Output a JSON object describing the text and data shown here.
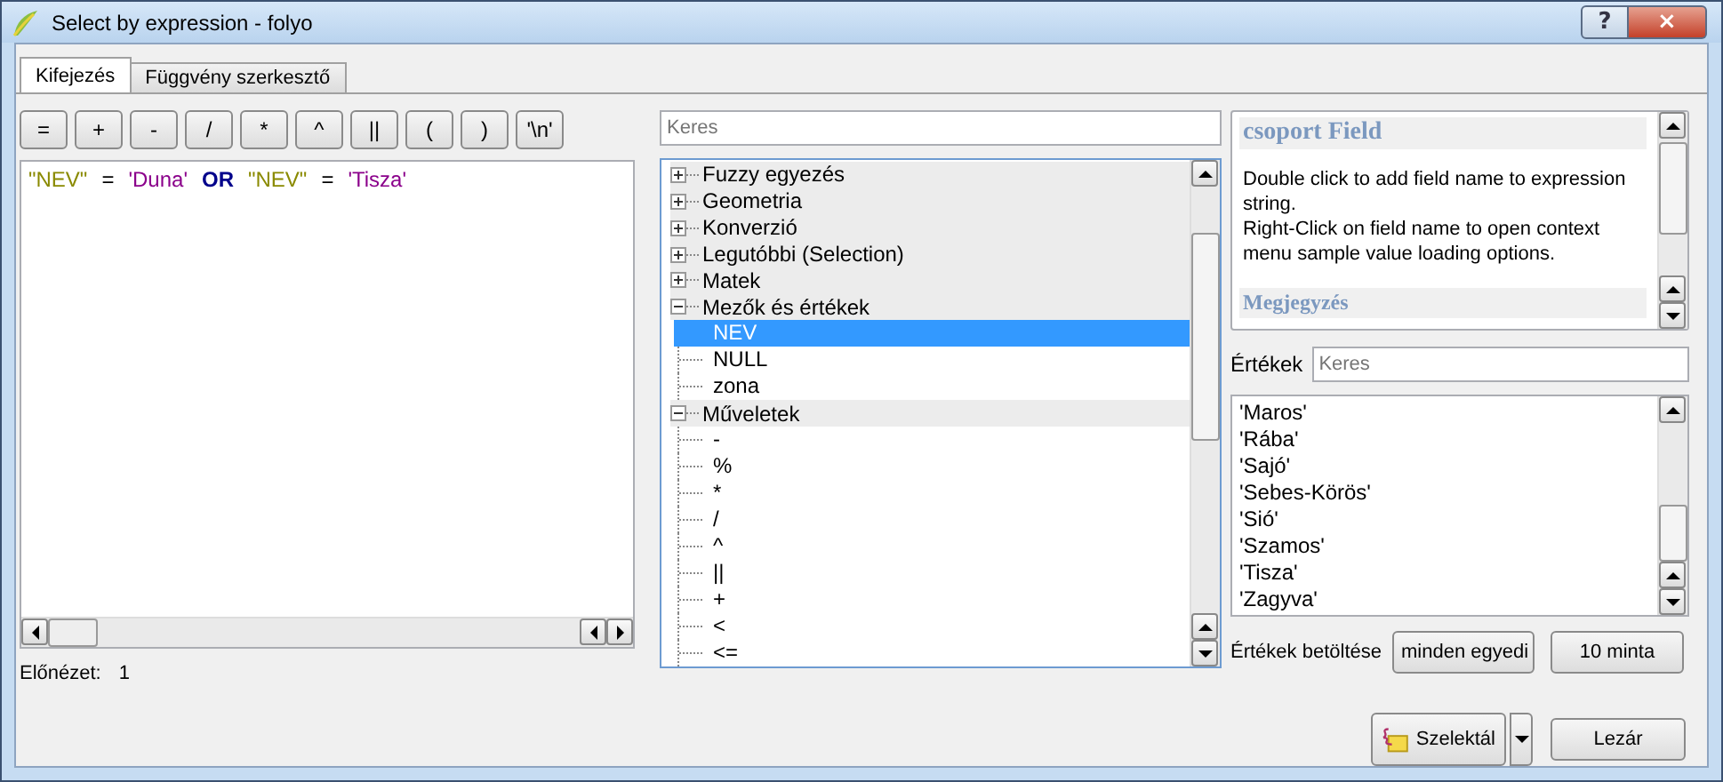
{
  "window": {
    "title": "Select by expression - folyo",
    "help_button": "?",
    "close_button": "×"
  },
  "tabs": [
    {
      "label": "Kifejezés",
      "selected": true
    },
    {
      "label": "Függvény szerkesztő",
      "selected": false
    }
  ],
  "operators": [
    "=",
    "+",
    "-",
    "/",
    "*",
    "^",
    "||",
    "(",
    ")",
    "'\\n'"
  ],
  "expression": [
    {
      "kind": "field",
      "text": "\"NEV\""
    },
    {
      "kind": "operator",
      "text": "="
    },
    {
      "kind": "string",
      "text": "'Duna'"
    },
    {
      "kind": "keyword",
      "text": "OR"
    },
    {
      "kind": "field",
      "text": "\"NEV\""
    },
    {
      "kind": "operator",
      "text": "="
    },
    {
      "kind": "string",
      "text": "'Tisza'"
    }
  ],
  "preview": {
    "label": "Előnézet:",
    "value": "1"
  },
  "function_search": {
    "placeholder": "Keres"
  },
  "function_tree": [
    {
      "label": "Fuzzy egyezés",
      "expanded": false,
      "selected": false
    },
    {
      "label": "Geometria",
      "expanded": false,
      "selected": false
    },
    {
      "label": "Konverzió",
      "expanded": false,
      "selected": false
    },
    {
      "label": "Legutóbbi (Selection)",
      "expanded": false,
      "selected": false
    },
    {
      "label": "Matek",
      "expanded": false,
      "selected": false
    },
    {
      "label": "Mezők és értékek",
      "expanded": true,
      "selected": false,
      "children": [
        {
          "label": "NEV",
          "selected": true
        },
        {
          "label": "NULL",
          "selected": false
        },
        {
          "label": "zona",
          "selected": false
        }
      ]
    },
    {
      "label": "Műveletek",
      "expanded": true,
      "selected": false,
      "children": [
        {
          "label": "-",
          "selected": false
        },
        {
          "label": "%",
          "selected": false
        },
        {
          "label": "*",
          "selected": false
        },
        {
          "label": "/",
          "selected": false
        },
        {
          "label": "^",
          "selected": false
        },
        {
          "label": "||",
          "selected": false
        },
        {
          "label": "+",
          "selected": false
        },
        {
          "label": "<",
          "selected": false
        },
        {
          "label": "<=",
          "selected": false
        }
      ]
    }
  ],
  "help": {
    "title": "csoport Field",
    "paragraphs": [
      "Double click to add field name to expression string.",
      "Right-Click on field name to open context menu sample value loading options."
    ],
    "note_heading": "Megjegyzés"
  },
  "values": {
    "label": "Értékek",
    "search_placeholder": "Keres",
    "items": [
      "'Maros'",
      "'Rába'",
      "'Sajó'",
      "'Sebes-Körös'",
      "'Sió'",
      "'Szamos'",
      "'Tisza'",
      "'Zagyva'"
    ],
    "load_label": "Értékek betöltése",
    "load_buttons": [
      "minden egyedi",
      "10 minta"
    ]
  },
  "buttons": {
    "select": "Szelektál",
    "close": "Lezár"
  }
}
